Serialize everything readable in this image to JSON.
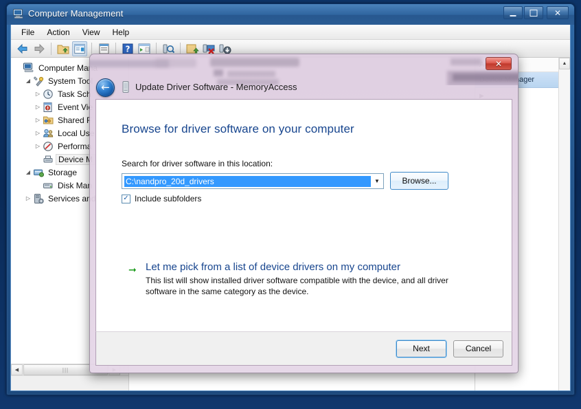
{
  "window": {
    "title": "Computer Management",
    "title_icon": "computer-icon",
    "buttons": {
      "minimize": "Minimize",
      "maximize": "Maximize",
      "close": "Close"
    }
  },
  "menubar": {
    "items": [
      {
        "label": "File"
      },
      {
        "label": "Action"
      },
      {
        "label": "View"
      },
      {
        "label": "Help"
      }
    ]
  },
  "toolbar": {
    "items": [
      {
        "name": "back-icon",
        "title": "Back"
      },
      {
        "name": "forward-icon",
        "title": "Forward"
      },
      {
        "name": "up-folder-icon",
        "title": "Up one level"
      },
      {
        "name": "show-hide-tree-icon",
        "title": "Show/Hide Console Tree"
      },
      {
        "name": "properties-icon",
        "title": "Properties"
      },
      {
        "name": "help-icon",
        "title": "Help"
      },
      {
        "name": "show-hide-action-pane-icon",
        "title": "Show/Hide Action Pane"
      },
      {
        "name": "scan-hardware-icon",
        "title": "Scan for hardware changes"
      },
      {
        "name": "update-driver-icon",
        "title": "Update Driver Software"
      },
      {
        "name": "disable-device-icon",
        "title": "Disable device"
      },
      {
        "name": "uninstall-device-icon",
        "title": "Uninstall device"
      }
    ]
  },
  "tree": {
    "nodes": [
      {
        "label": "Computer Mana",
        "icon": "computer-icon",
        "indent": 0,
        "expander": "",
        "selected": false
      },
      {
        "label": "System Tool",
        "icon": "system-tools-icon",
        "indent": 1,
        "expander": "◢",
        "selected": false
      },
      {
        "label": "Task Sch",
        "icon": "task-scheduler-icon",
        "indent": 2,
        "expander": "▷",
        "selected": false
      },
      {
        "label": "Event Vie",
        "icon": "event-viewer-icon",
        "indent": 2,
        "expander": "▷",
        "selected": false
      },
      {
        "label": "Shared F",
        "icon": "shared-folders-icon",
        "indent": 2,
        "expander": "▷",
        "selected": false
      },
      {
        "label": "Local Use",
        "icon": "local-users-icon",
        "indent": 2,
        "expander": "▷",
        "selected": false
      },
      {
        "label": "Performa",
        "icon": "performance-icon",
        "indent": 2,
        "expander": "▷",
        "selected": false
      },
      {
        "label": "Device M",
        "icon": "device-manager-icon",
        "indent": 2,
        "expander": "",
        "selected": true
      },
      {
        "label": "Storage",
        "icon": "storage-icon",
        "indent": 1,
        "expander": "◢",
        "selected": false
      },
      {
        "label": "Disk Man",
        "icon": "disk-management-icon",
        "indent": 2,
        "expander": "",
        "selected": false
      },
      {
        "label": "Services and",
        "icon": "services-icon",
        "indent": 1,
        "expander": "▷",
        "selected": false
      }
    ]
  },
  "actions_pane": {
    "header": "Actions",
    "selected_row": "Device Manager",
    "collapse_icon": "chevron-up-icon",
    "expand_icon": "chevron-right-icon"
  },
  "scrollbars": {
    "h_left_arrow": "◀",
    "h_right_arrow": "▶",
    "h_thumb_grip": "|||",
    "v_up_arrow": "▲",
    "v_down_arrow": "▼"
  },
  "dialog": {
    "title": "Update Driver Software - MemoryAccess",
    "title_icon": "memory-device-icon",
    "back_button": "←",
    "close_button": "✕",
    "heading": "Browse for driver software on your computer",
    "location_label": "Search for driver software in this location:",
    "location_value": "C:\\nandpro_20d_drivers",
    "location_dropdown_icon": "chevron-down-icon",
    "browse_label": "Browse...",
    "include_subfolders_label": "Include subfolders",
    "include_subfolders_checked": true,
    "checkbox_glyph": "✓",
    "pick_arrow_icon": "green-arrow-right-icon",
    "pick_link": "Let me pick from a list of device drivers on my computer",
    "pick_description": "This list will show installed driver software compatible with the device, and all driver software in the same category as the device.",
    "next_label": "Next",
    "cancel_label": "Cancel"
  },
  "colors": {
    "heading_blue": "#17458e",
    "link_blue": "#17458e",
    "selection_blue": "#3399ff",
    "green_arrow": "#1a9a1a",
    "dialog_glass": "#e2d0e2",
    "close_red": "#c0392c",
    "frame_blue": "#24578f"
  }
}
